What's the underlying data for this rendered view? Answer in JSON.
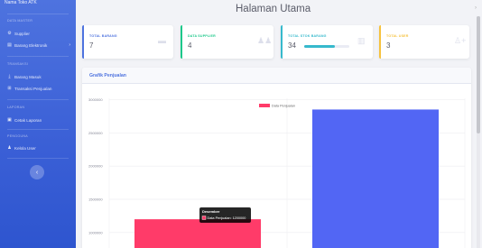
{
  "app": {
    "brand": "Nama Toko ATK"
  },
  "header": {
    "title": "Halaman Utama"
  },
  "sidebar": {
    "sections": [
      {
        "heading": "DATA MASTER",
        "items": [
          {
            "label": "Supplier",
            "icon": "truck-icon"
          },
          {
            "label": "Barang Elektronik",
            "icon": "box-icon",
            "has_chevron": true
          }
        ]
      },
      {
        "heading": "TRANSAKSI",
        "items": [
          {
            "label": "Barang Masuk",
            "icon": "download-icon"
          },
          {
            "label": "Transaksi Penjualan",
            "icon": "cart-icon"
          }
        ]
      },
      {
        "heading": "LAPORAN",
        "items": [
          {
            "label": "Cetak Laporan",
            "icon": "print-icon"
          }
        ]
      },
      {
        "heading": "PENGGUNA",
        "items": [
          {
            "label": "Kelola User",
            "icon": "users-icon"
          }
        ]
      }
    ]
  },
  "cards": [
    {
      "label": "TOTAL BARANG",
      "value": "7",
      "color": "#4e73df",
      "icon": "folder-icon"
    },
    {
      "label": "DATA SUPPLIER",
      "value": "4",
      "color": "#1cc88a",
      "icon": "users-icon"
    },
    {
      "label": "TOTAL STOK BARANG",
      "value": "34",
      "color": "#36b9cc",
      "icon": "box-icon",
      "progress": 0.68
    },
    {
      "label": "TOTAL USER",
      "value": "3",
      "color": "#f6c23e",
      "icon": "user-plus-icon"
    }
  ],
  "chart": {
    "title": "Grafik Penjualan",
    "tooltip": {
      "title": "Desember",
      "text": "Data Penjualan: 1200000"
    }
  },
  "chart_data": {
    "type": "bar",
    "title": "",
    "categories": [
      "Desember",
      ""
    ],
    "series": [
      {
        "name": "Data Penjualan",
        "values": [
          1200000,
          2850000
        ],
        "colors": [
          "#ff3b69",
          "#5266f4"
        ]
      }
    ],
    "yticks": [
      1000000,
      1500000,
      2000000,
      2500000,
      3000000
    ],
    "ylim": [
      700000,
      3100000
    ],
    "legend": "top",
    "grid": true
  }
}
